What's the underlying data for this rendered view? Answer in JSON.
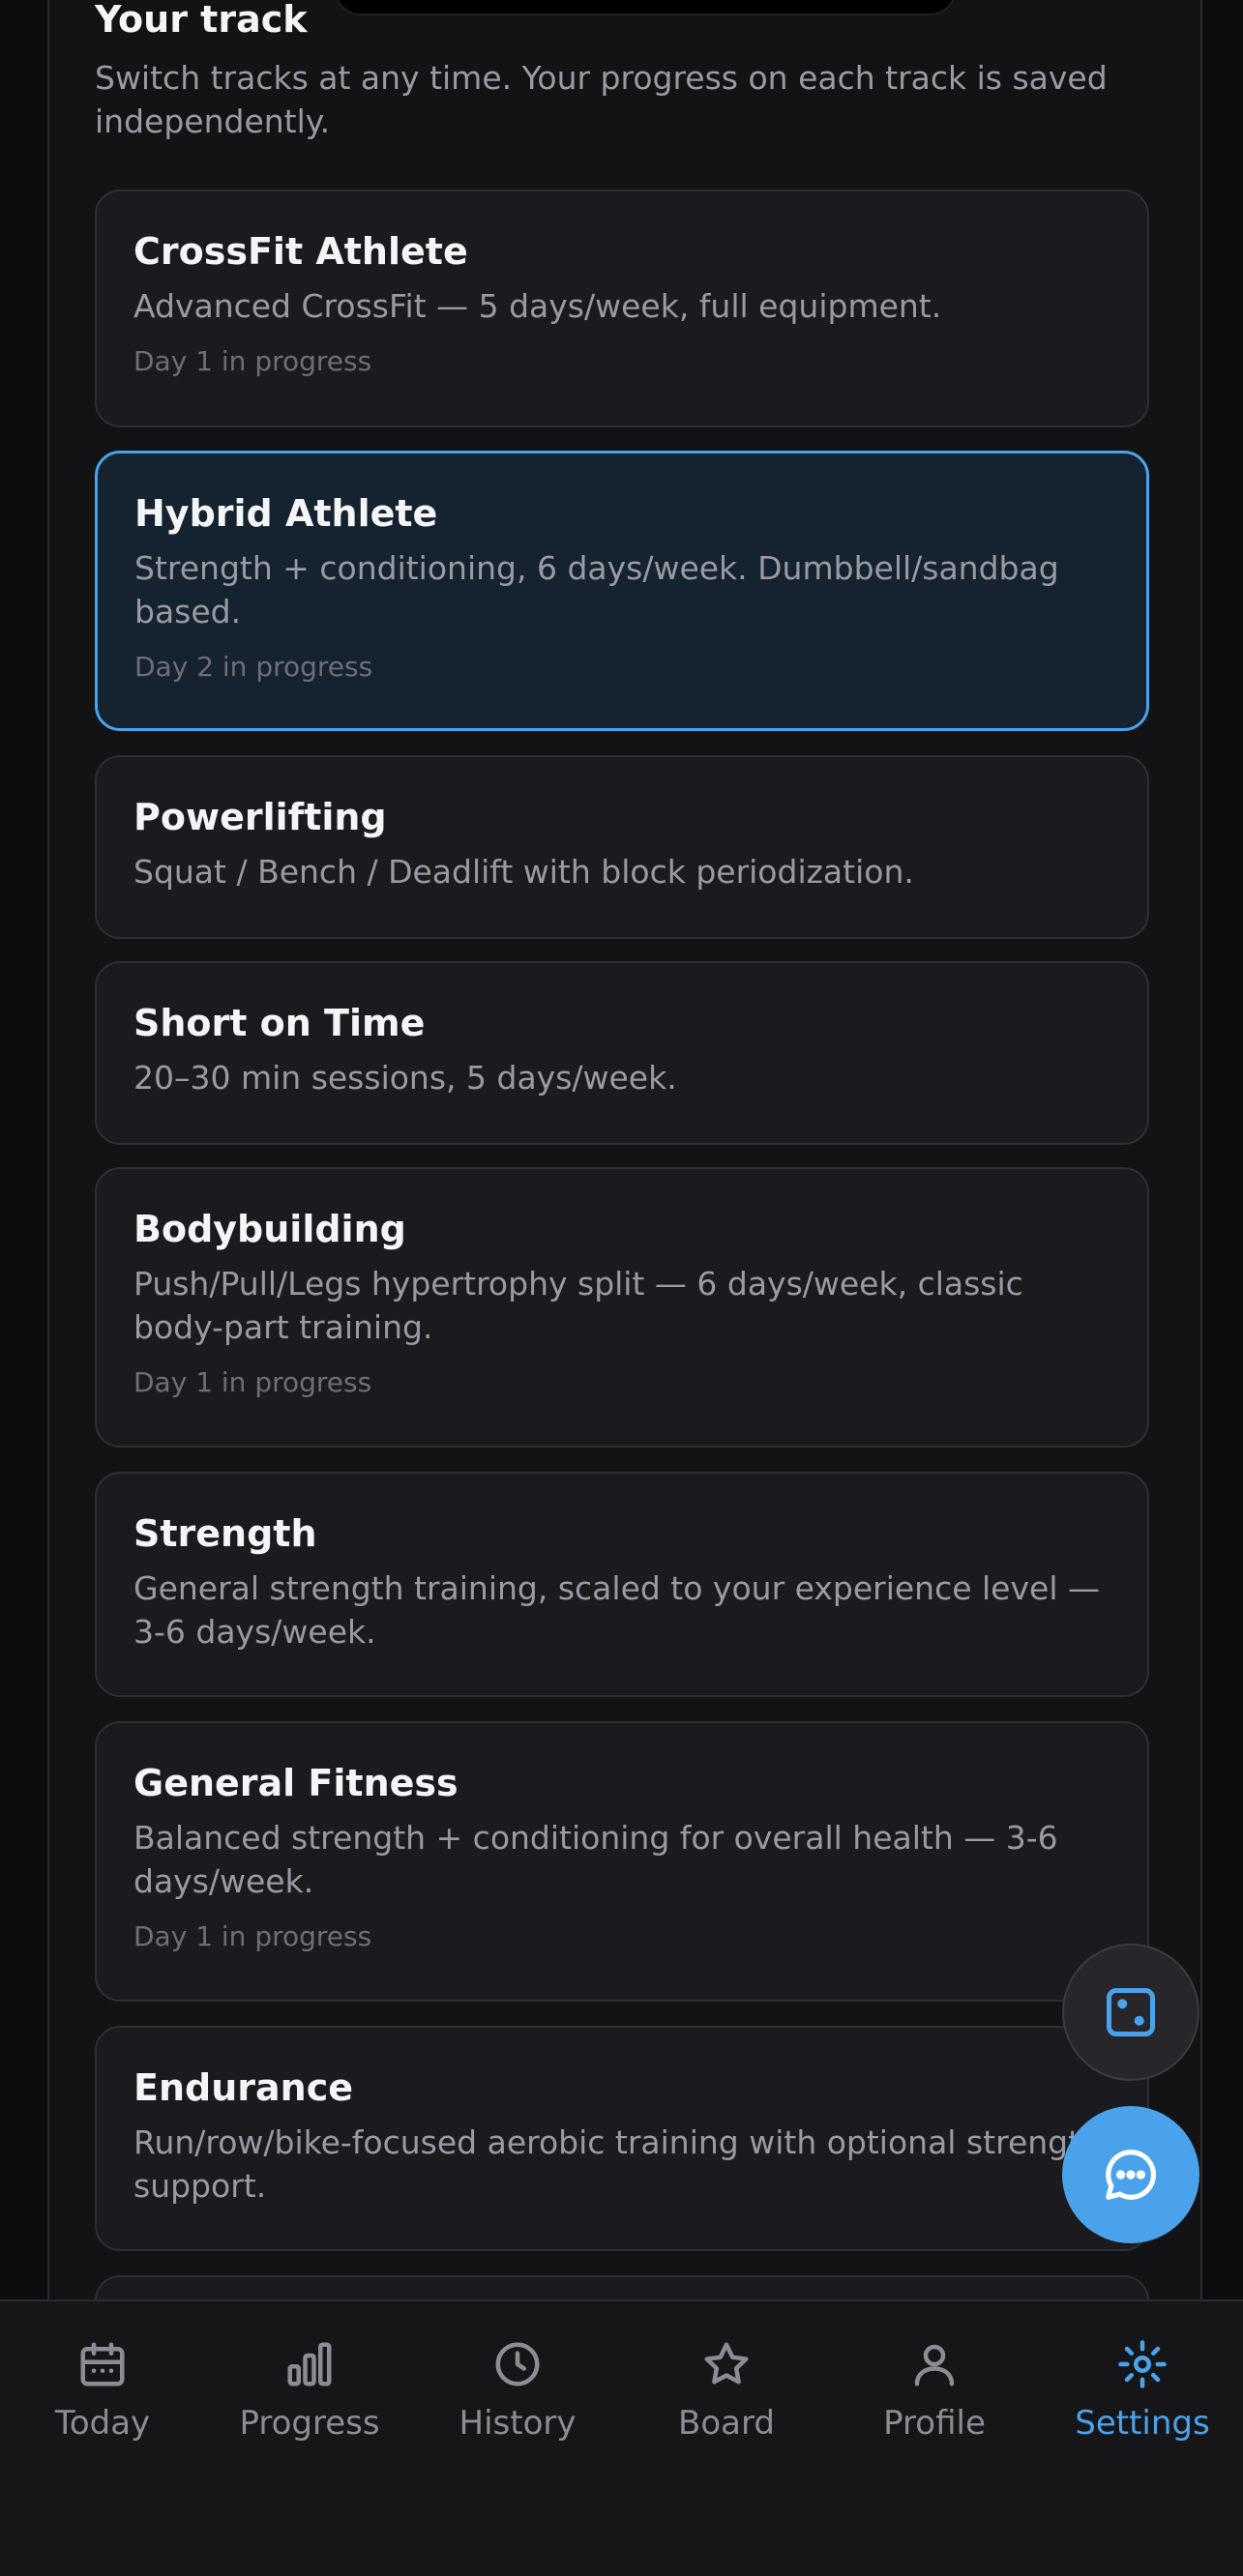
{
  "track_section": {
    "title": "Your track",
    "subtitle": "Switch tracks at any time. Your progress on each track is saved independently."
  },
  "tracks": [
    {
      "name": "CrossFit Athlete",
      "description": "Advanced CrossFit — 5 days/week, full equipment.",
      "progress": "Day 1 in progress",
      "selected": false
    },
    {
      "name": "Hybrid Athlete",
      "description": "Strength + conditioning, 6 days/week. Dumbbell/sandbag based.",
      "progress": "Day 2 in progress",
      "selected": true
    },
    {
      "name": "Powerlifting",
      "description": "Squat / Bench / Deadlift with block periodization.",
      "progress": "",
      "selected": false
    },
    {
      "name": "Short on Time",
      "description": "20–30 min sessions, 5 days/week.",
      "progress": "",
      "selected": false
    },
    {
      "name": "Bodybuilding",
      "description": "Push/Pull/Legs hypertrophy split — 6 days/week, classic body-part training.",
      "progress": "Day 1 in progress",
      "selected": false
    },
    {
      "name": "Strength",
      "description": "General strength training, scaled to your experience level — 3-6 days/week.",
      "progress": "",
      "selected": false
    },
    {
      "name": "General Fitness",
      "description": "Balanced strength + conditioning for overall health — 3-6 days/week.",
      "progress": "Day 1 in progress",
      "selected": false
    },
    {
      "name": "Endurance",
      "description": "Run/row/bike-focused aerobic training with optional strength support.",
      "progress": "",
      "selected": false
    }
  ],
  "fabs": {
    "dice_icon": "dice-icon",
    "chat_icon": "chat-bubble-icon"
  },
  "tabbar": {
    "tabs": [
      {
        "label": "Today",
        "icon": "calendar-icon"
      },
      {
        "label": "Progress",
        "icon": "bar-chart-icon"
      },
      {
        "label": "History",
        "icon": "clock-icon"
      },
      {
        "label": "Board",
        "icon": "star-icon"
      },
      {
        "label": "Profile",
        "icon": "user-icon"
      },
      {
        "label": "Settings",
        "icon": "gear-icon"
      }
    ],
    "active_tab": "Settings"
  },
  "colors": {
    "background": "#0c0c0e",
    "panel": "#131316",
    "card": "#1b1b1f",
    "selected_card": "#152230",
    "accent": "#4aa3ea",
    "muted_text": "#9a9aa2"
  }
}
